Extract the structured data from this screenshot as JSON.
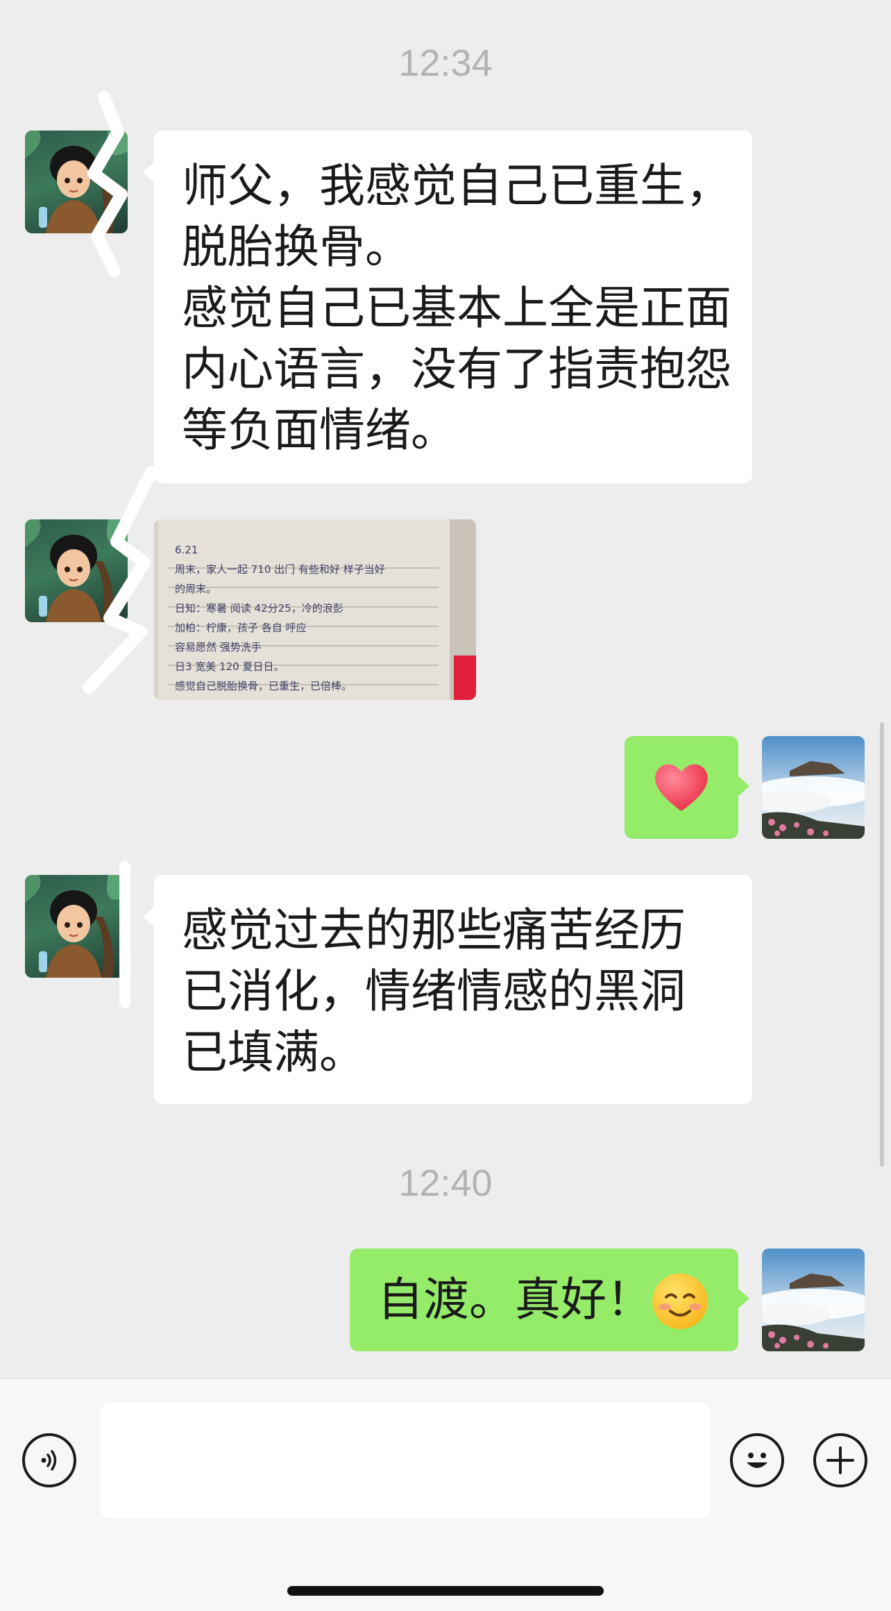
{
  "chat": {
    "timestamp_1": "12:34",
    "msg_1": "师父，我感觉自己已重生，脱胎换骨。",
    "msg_1b": "感觉自己已基本上全是正面内心语言，没有了指责抱怨等负面情绪。",
    "msg_4": "感觉过去的那些痛苦经历已消化，情绪情感的黑洞已填满。",
    "timestamp_2": "12:40",
    "msg_5_text": "自渡。真好！",
    "heart_icon": "heart-emoji",
    "smile_icon": "smiling-face-emoji"
  },
  "note_photo": {
    "lines": [
      "6.21",
      "周末，家人一起 710 出门 有些和好 样子当好",
      "的周末。",
      "日知：寒暑 阅读 42分25，冷的浪彭",
      "加柏：柠康，孩子 各自 呼应",
      "容易愿然 强势洗手",
      "日3 宽美  120 夏日日。",
      "感觉自己脱胎换骨，已重生，已倍棒。"
    ]
  },
  "input_bar": {
    "placeholder": "",
    "voice_icon": "voice-icon",
    "emoji_icon": "emoji-icon",
    "plus_icon": "plus-icon"
  },
  "colors": {
    "background": "#ededed",
    "incoming_bubble": "#ffffff",
    "outgoing_bubble": "#95ec69",
    "timestamp": "#b2b2b2"
  }
}
